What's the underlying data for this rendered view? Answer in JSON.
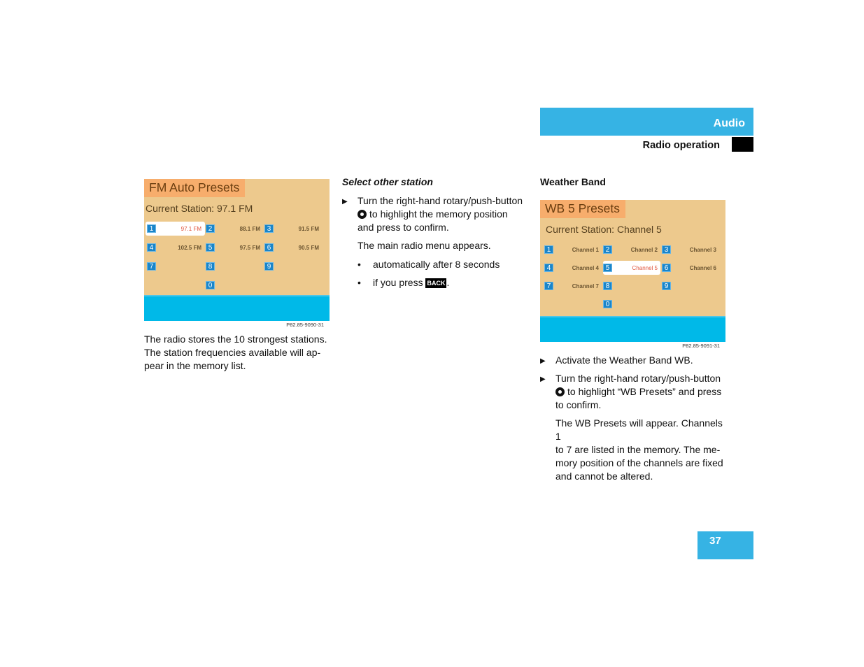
{
  "header": {
    "section": "Audio",
    "subsection": "Radio operation"
  },
  "page_number": "37",
  "fm_screen": {
    "title": "FM Auto Presets",
    "current": "Current Station: 97.1 FM",
    "presets": [
      {
        "n": "1",
        "label": "97.1 FM",
        "selected": true
      },
      {
        "n": "2",
        "label": "88.1 FM"
      },
      {
        "n": "3",
        "label": "91.5 FM"
      },
      {
        "n": "4",
        "label": "102.5 FM"
      },
      {
        "n": "5",
        "label": "97.5 FM"
      },
      {
        "n": "6",
        "label": "90.5 FM"
      },
      {
        "n": "7",
        "label": ""
      },
      {
        "n": "8",
        "label": ""
      },
      {
        "n": "9",
        "label": ""
      },
      {
        "n": "0",
        "label": ""
      }
    ],
    "caption": "P82.85-9090-31"
  },
  "fm_text": "The radio stores the 10 strongest stations. The station frequencies available will ap-pear in the memory list.",
  "fm_text_lines": [
    "The radio stores the 10 strongest stations.",
    "The station frequencies available will ap-",
    "pear in the memory list."
  ],
  "select_station": {
    "heading": "Select other station",
    "step_line1": "Turn the right-hand rotary/push-button",
    "step_line2": "to highlight the memory position",
    "step_line3": "and press to confirm.",
    "result": "The main radio menu appears.",
    "bullet1": "automatically after 8 seconds",
    "bullet2_prefix": "if you press",
    "back_key": "BACK",
    "bullet2_suffix": "."
  },
  "weather": {
    "heading": "Weather Band",
    "screen": {
      "title": "WB 5 Presets",
      "current": "Current Station: Channel 5",
      "presets": [
        {
          "n": "1",
          "label": "Channel 1"
        },
        {
          "n": "2",
          "label": "Channel 2"
        },
        {
          "n": "3",
          "label": "Channel 3"
        },
        {
          "n": "4",
          "label": "Channel 4"
        },
        {
          "n": "5",
          "label": "Channel 5",
          "selected": true
        },
        {
          "n": "6",
          "label": "Channel 6"
        },
        {
          "n": "7",
          "label": "Channel 7"
        },
        {
          "n": "8",
          "label": ""
        },
        {
          "n": "9",
          "label": ""
        },
        {
          "n": "0",
          "label": ""
        }
      ],
      "caption": "P82.85-9091-31"
    },
    "step1": "Activate the Weather Band WB.",
    "step2_line1": "Turn the right-hand rotary/push-button",
    "step2_line2": "to highlight “WB Presets” and press",
    "step2_line3": "to confirm.",
    "result_lines": [
      "The WB Presets will appear. Channels 1",
      "to 7 are listed in the memory. The me-",
      "mory position of the channels are fixed",
      "and cannot be altered."
    ]
  },
  "icons": {
    "step_arrow": "▶",
    "bullet": "•"
  }
}
